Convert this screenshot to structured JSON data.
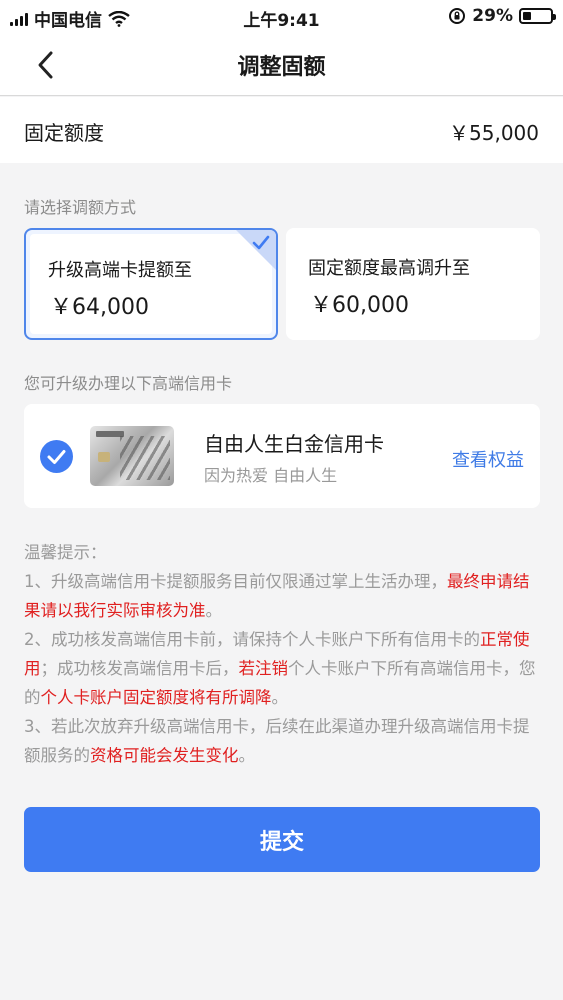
{
  "status_bar": {
    "carrier": "中国电信",
    "time": "上午9:41",
    "battery": "29%",
    "battery_level": 0.29
  },
  "nav": {
    "title": "调整固额",
    "back_icon": "chevron-left-icon"
  },
  "fixed_limit": {
    "label": "固定额度",
    "value": "￥55,000"
  },
  "adjust": {
    "section_label": "请选择调额方式",
    "options": [
      {
        "title": "升级高端卡提额至",
        "value": "￥64,000",
        "selected": true
      },
      {
        "title": "固定额度最高调升至",
        "value": "￥60,000",
        "selected": false
      }
    ]
  },
  "upgrade": {
    "section_label": "您可升级办理以下高端信用卡",
    "card": {
      "name": "自由人生白金信用卡",
      "subtitle": "因为热爱 自由人生",
      "link": "查看权益",
      "checked": true
    }
  },
  "tips": {
    "heading": "温馨提示：",
    "item1_a": "1、升级高端信用卡提额服务目前仅限通过掌上生活办理，",
    "item1_red": "最终申请结果请以我行实际审核为准",
    "item1_b": "。",
    "item2_a": "2、成功核发高端信用卡前，请保持个人卡账户下所有信用卡的",
    "item2_red1": "正常使用",
    "item2_b": "；成功核发高端信用卡后，",
    "item2_red2": "若注销",
    "item2_c": "个人卡账户下所有高端信用卡，您的",
    "item2_red3": "个人卡账户固定额度将有所调降",
    "item2_d": "。",
    "item3_a": "3、若此次放弃升级高端信用卡，后续在此渠道办理升级高端信用卡提额服务的",
    "item3_red": "资格可能会发生变化",
    "item3_b": "。"
  },
  "submit_label": "提交",
  "colors": {
    "accent": "#3f7bf2",
    "link": "#3f7be6",
    "warning": "#e02020",
    "page_bg": "#f4f4f5"
  }
}
